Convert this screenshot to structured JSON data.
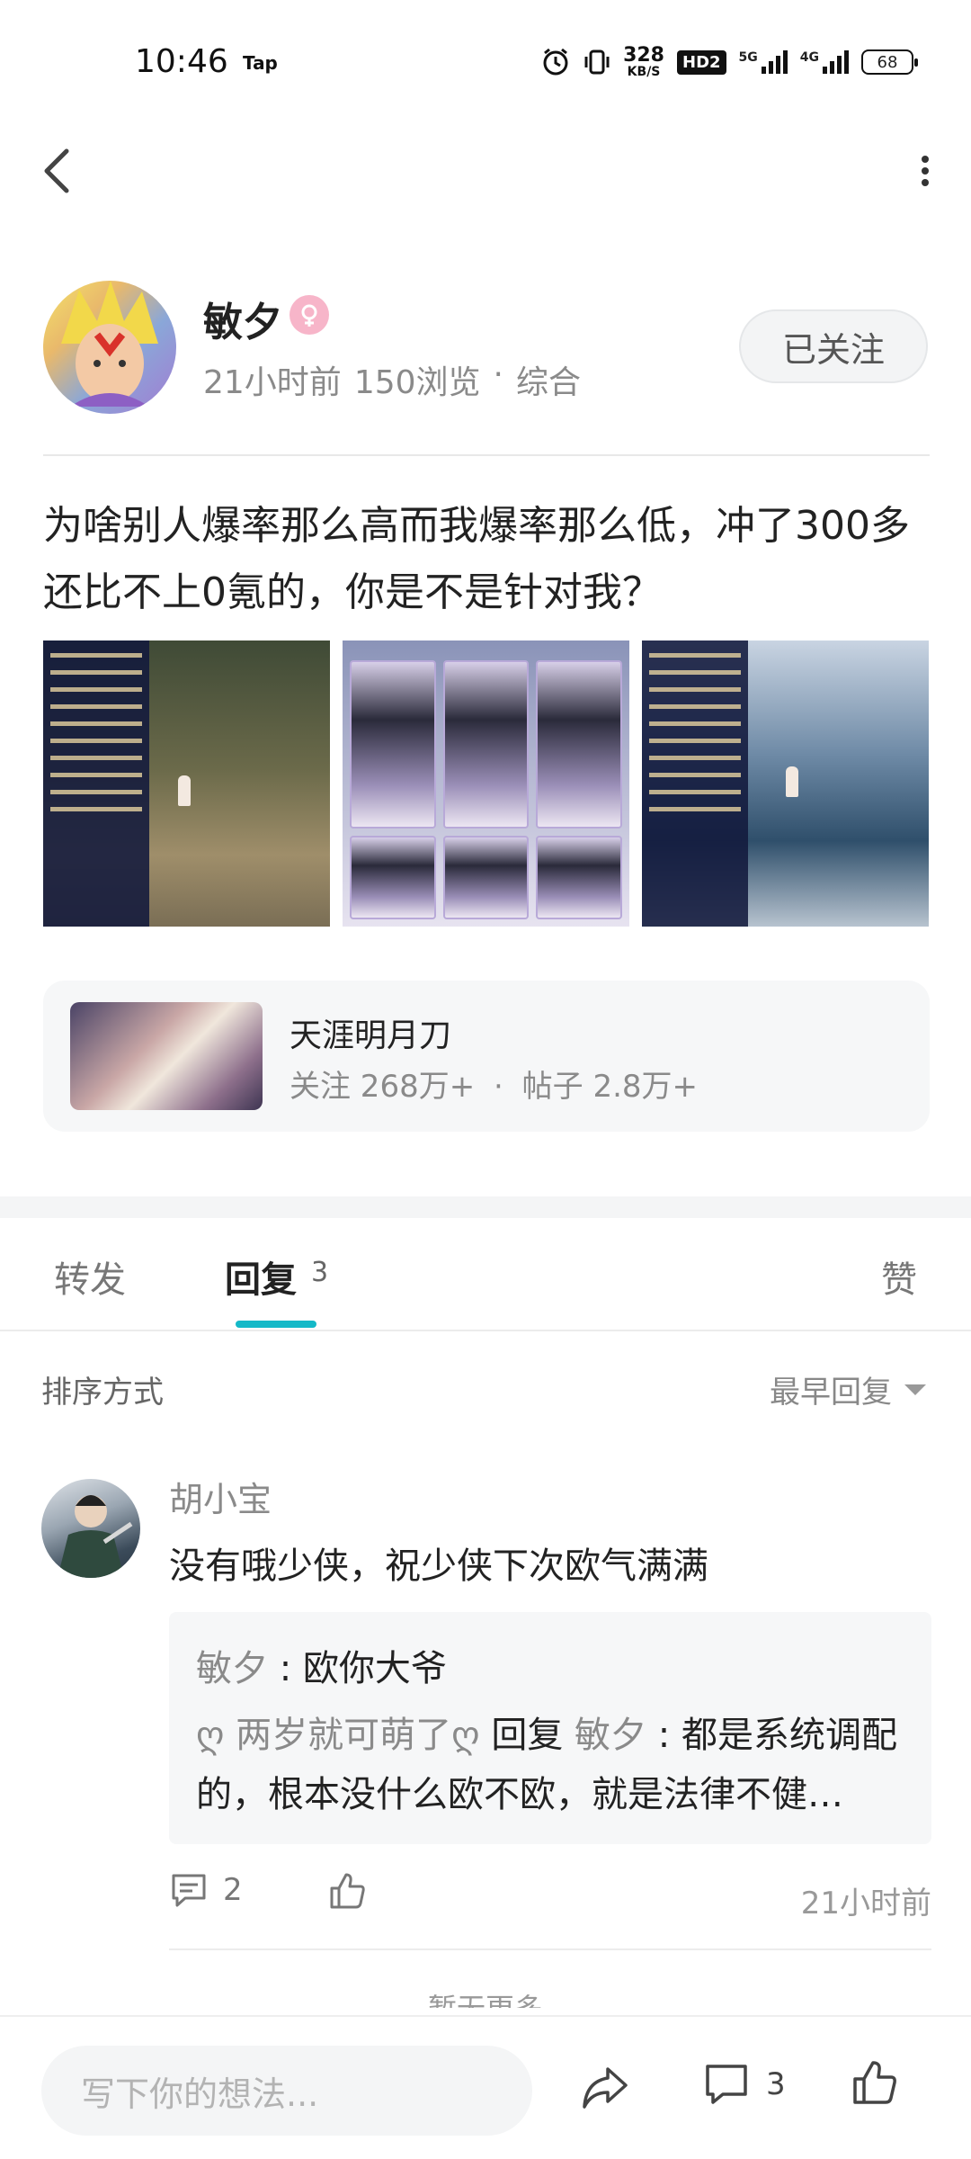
{
  "status_bar": {
    "time": "10:46",
    "app_tag": "Tap",
    "net_speed_value": "328",
    "net_speed_unit": "KB/S",
    "hd_label": "HD2",
    "net1_label": "5G",
    "net2_label": "4G",
    "battery": "68"
  },
  "author": {
    "name": "敏夕",
    "posted_ago": "21小时前",
    "views": "150浏览",
    "separator": "·",
    "category": "综合",
    "follow_label": "已关注"
  },
  "post": {
    "text": "为啥别人爆率那么高而我爆率那么低，冲了300多还比不上0氪的，你是不是针对我？",
    "image_count": 3
  },
  "forum": {
    "name": "天涯明月刀",
    "followers": "关注 268万+",
    "separator": "·",
    "posts": "帖子 2.8万+"
  },
  "tabs": {
    "repost": "转发",
    "reply": "回复",
    "reply_count": "3",
    "like": "赞",
    "active": "回复",
    "accent_color": "#14b9c8"
  },
  "sort": {
    "label": "排序方式",
    "selected": "最早回复"
  },
  "comment": {
    "author": "胡小宝",
    "body": "没有哦少侠，祝少侠下次欧气满满",
    "replies": [
      {
        "name": "敏夕",
        "colon": " : ",
        "text": "欧你大爷"
      },
      {
        "name": "ღ 两岁就可萌了ღ",
        "verb": " 回复 ",
        "target": "敏夕",
        "colon": " : ",
        "text": "都是系统调配的，根本没什么欧不欧，就是法律不健…"
      }
    ],
    "reply_count": "2",
    "time": "21小时前"
  },
  "footer_text": "暂无更多",
  "bottom_bar": {
    "input_placeholder": "写下你的想法...",
    "comment_count": "3"
  }
}
